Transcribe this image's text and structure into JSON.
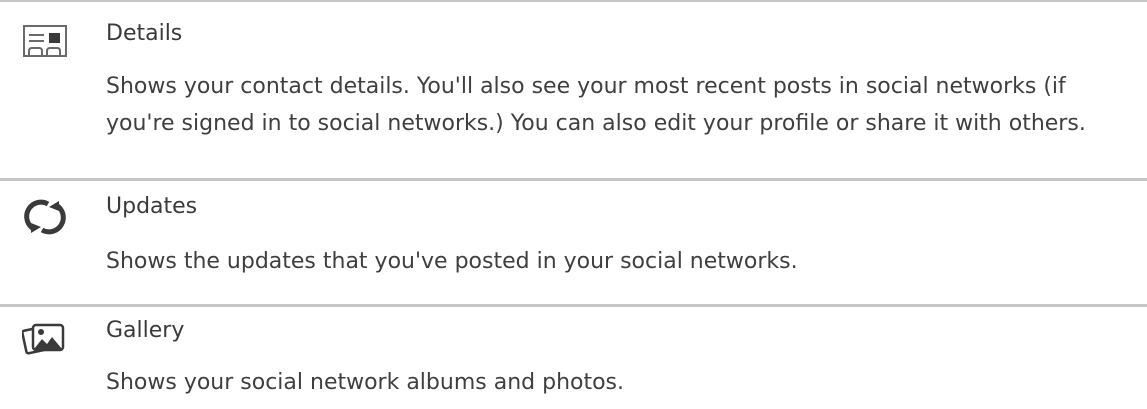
{
  "items": [
    {
      "icon": "contact-card-icon",
      "title": "Details",
      "description": "Shows your contact details. You'll also see your most recent posts in social networks (if you're signed in to social networks.) You can also edit your profile or share it with others."
    },
    {
      "icon": "refresh-icon",
      "title": "Updates",
      "description": "Shows the updates that you've posted in your social networks."
    },
    {
      "icon": "photo-gallery-icon",
      "title": "Gallery",
      "description": "Shows your social network albums and photos."
    }
  ]
}
